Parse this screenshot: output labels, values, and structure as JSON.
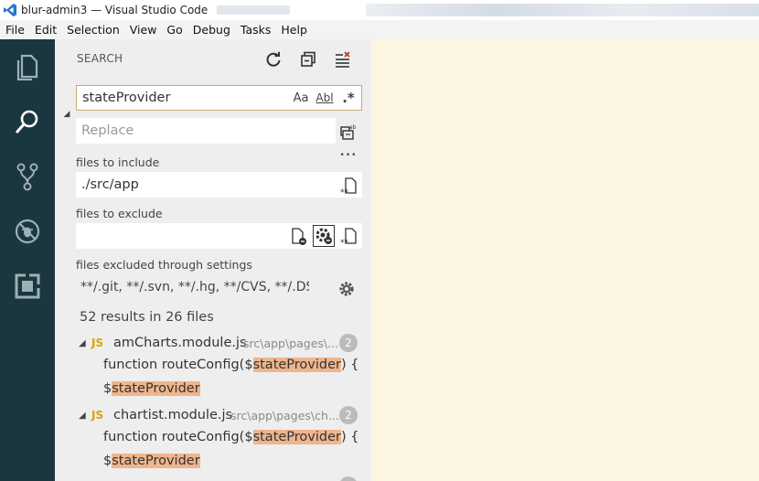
{
  "window": {
    "title": "blur-admin3 — Visual Studio Code"
  },
  "menu": [
    "File",
    "Edit",
    "Selection",
    "View",
    "Go",
    "Debug",
    "Tasks",
    "Help"
  ],
  "activity": [
    {
      "name": "explorer-icon"
    },
    {
      "name": "search-icon"
    },
    {
      "name": "source-control-icon"
    },
    {
      "name": "debug-icon"
    },
    {
      "name": "extensions-icon"
    }
  ],
  "search": {
    "header": "SEARCH",
    "query": "stateProvider",
    "opt_case": "Aa",
    "opt_word": "Abl",
    "opt_regex": ".*",
    "replace_placeholder": "Replace",
    "more_label": "•••",
    "include_label": "files to include",
    "include_value": "./src/app",
    "exclude_label": "files to exclude",
    "exclude_value": "",
    "excluded_settings_label": "files excluded through settings",
    "excluded_settings_value": "**/.git, **/.svn, **/.hg, **/CVS, **/.DS_S...",
    "summary": "52 results in 26 files"
  },
  "results": [
    {
      "file": "amCharts.module.js",
      "path": "src\\app\\pages\\...",
      "count": "2",
      "lines": [
        {
          "pre": "function routeConfig($",
          "hit": "stateProvider",
          "post": ") {"
        },
        {
          "pre": "$",
          "hit": "stateProvider",
          "post": ""
        }
      ]
    },
    {
      "file": "chartist.module.js",
      "path": "src\\app\\pages\\ch...",
      "count": "2",
      "lines": [
        {
          "pre": "function routeConfig($",
          "hit": "stateProvider",
          "post": ") {"
        },
        {
          "pre": "$",
          "hit": "stateProvider",
          "post": ""
        }
      ]
    }
  ],
  "colors": {
    "activitybar": "#1a3740",
    "sidebar": "#eeeeee",
    "editor": "#fdf6e3",
    "highlight": "#efb58c",
    "js_badge": "#e0a100"
  }
}
